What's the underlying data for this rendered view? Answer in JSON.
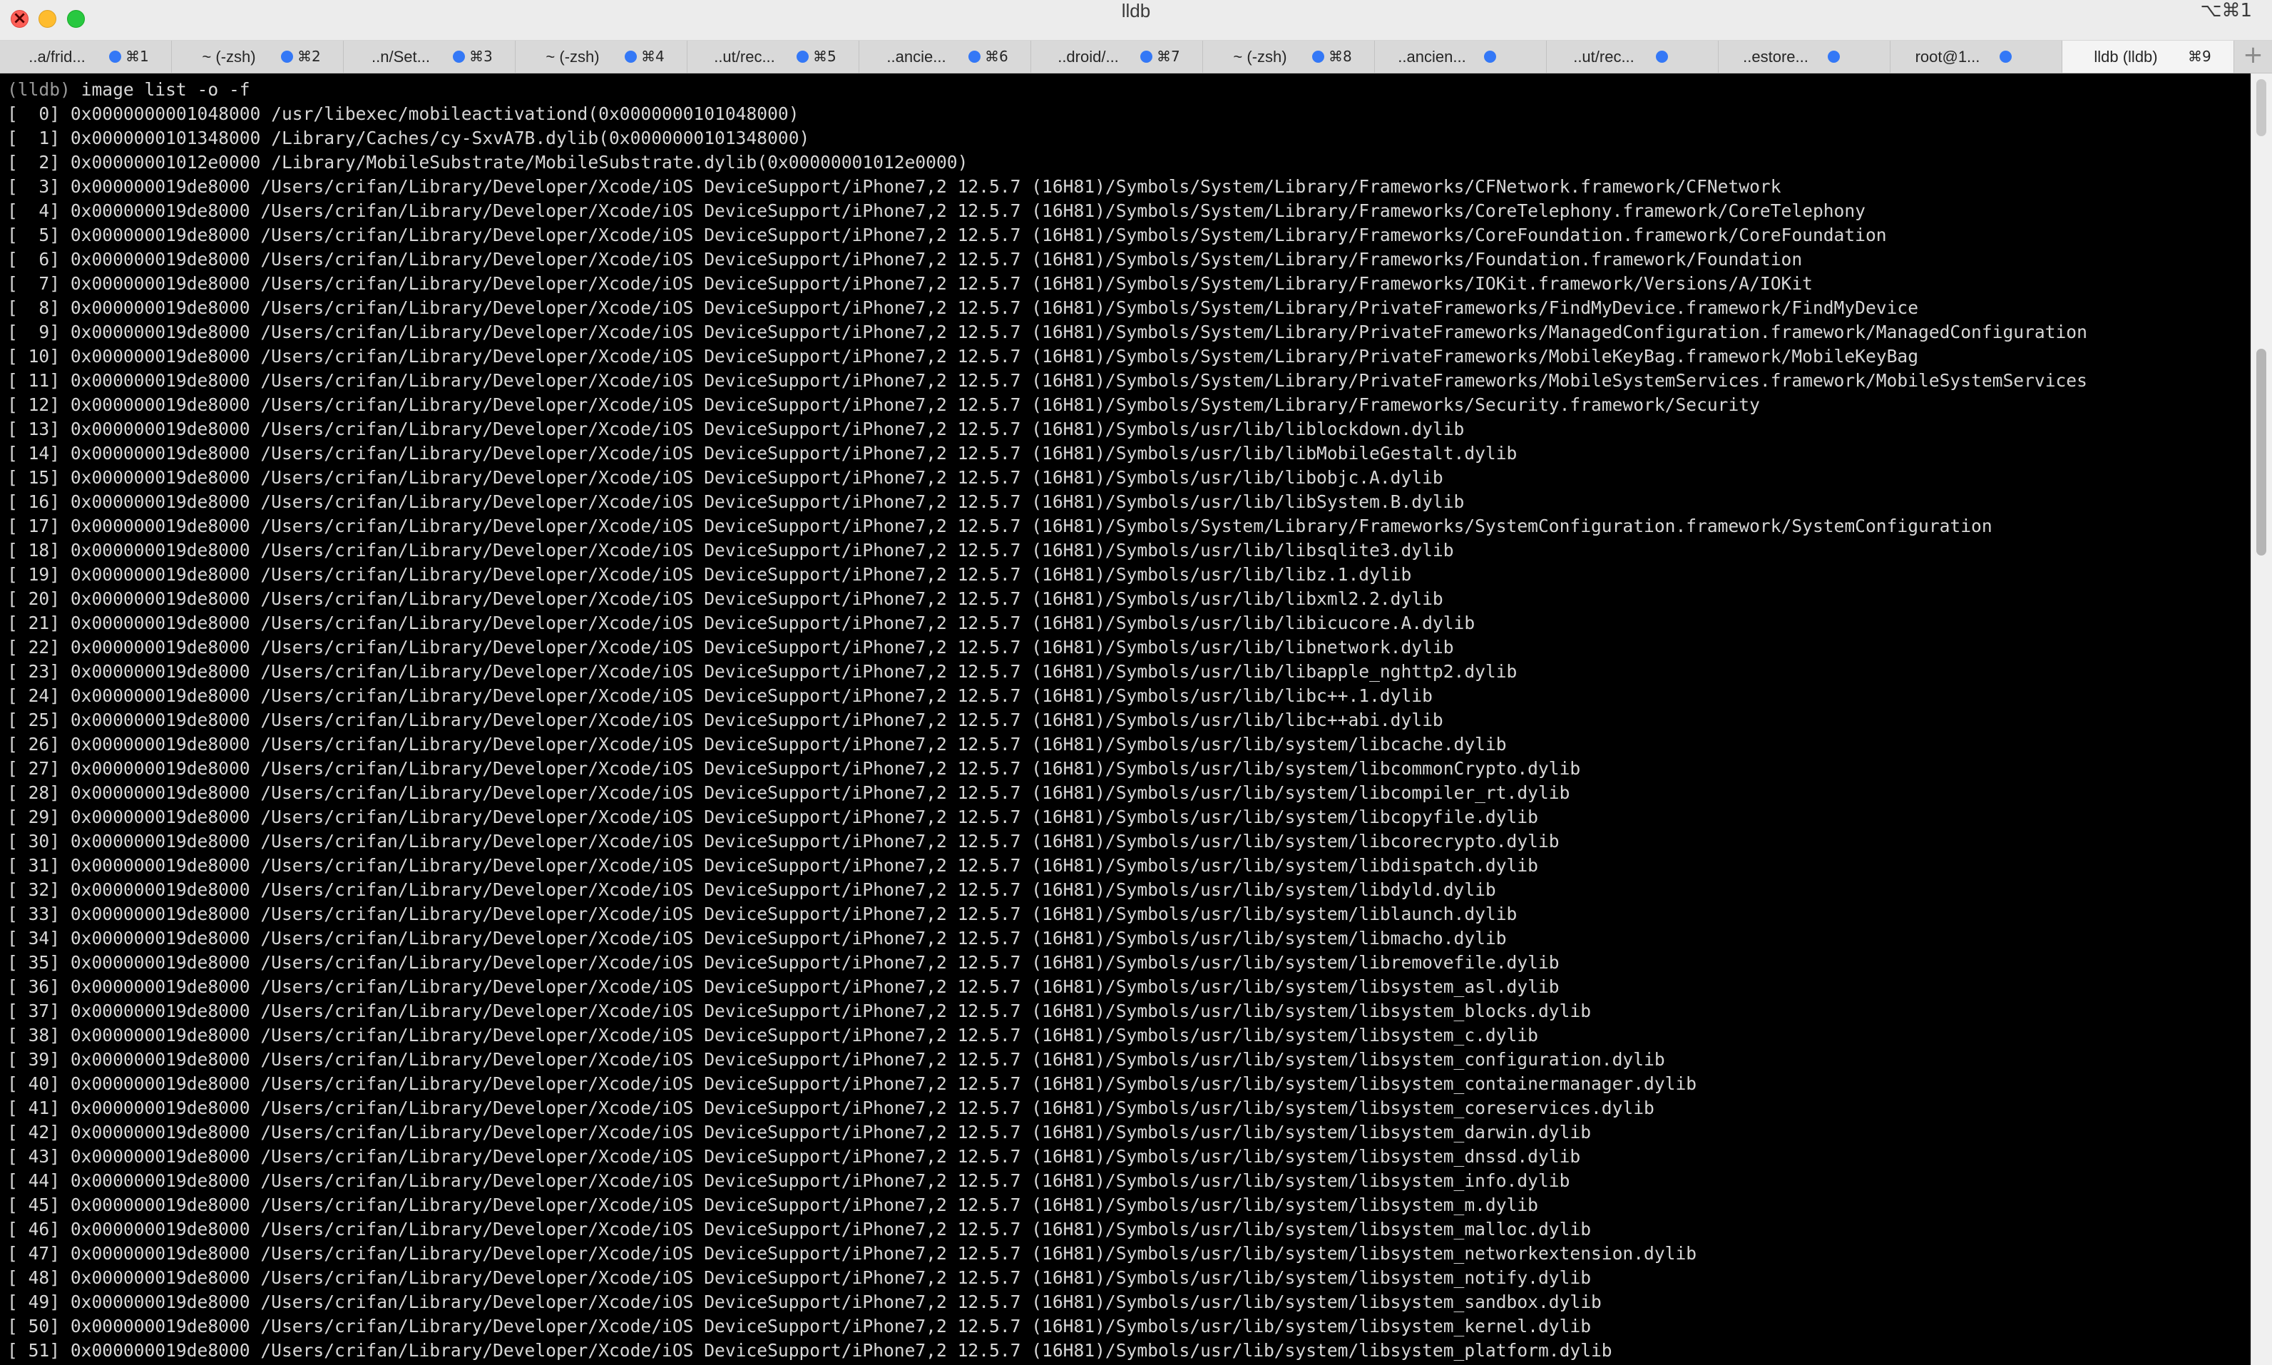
{
  "window": {
    "title": "lldb",
    "shortcut": "⌥⌘1"
  },
  "tabs": [
    {
      "title": "..a/frid...",
      "key": "⌘1"
    },
    {
      "title": "~ (-zsh)",
      "key": "⌘2"
    },
    {
      "title": "..n/Set...",
      "key": "⌘3"
    },
    {
      "title": "~ (-zsh)",
      "key": "⌘4"
    },
    {
      "title": "..ut/rec...",
      "key": "⌘5"
    },
    {
      "title": "..ancie...",
      "key": "⌘6"
    },
    {
      "title": "..droid/...",
      "key": "⌘7"
    },
    {
      "title": "~ (-zsh)",
      "key": "⌘8"
    },
    {
      "title": "..ancien...",
      "key": ""
    },
    {
      "title": "..ut/rec...",
      "key": ""
    },
    {
      "title": "..estore...",
      "key": ""
    },
    {
      "title": "root@1...",
      "key": ""
    },
    {
      "title": "lldb (lldb)",
      "key": "⌘9",
      "active": true
    }
  ],
  "new_tab_label": "+",
  "terminal": {
    "prompt": "(lldb)",
    "command": " image list -o -f",
    "lines": [
      "[  0] 0x0000000001048000 /usr/libexec/mobileactivationd(0x0000000101048000)",
      "[  1] 0x0000000101348000 /Library/Caches/cy-SxvA7B.dylib(0x0000000101348000)",
      "[  2] 0x00000001012e0000 /Library/MobileSubstrate/MobileSubstrate.dylib(0x00000001012e0000)",
      "[  3] 0x000000019de8000 /Users/crifan/Library/Developer/Xcode/iOS DeviceSupport/iPhone7,2 12.5.7 (16H81)/Symbols/System/Library/Frameworks/CFNetwork.framework/CFNetwork",
      "[  4] 0x000000019de8000 /Users/crifan/Library/Developer/Xcode/iOS DeviceSupport/iPhone7,2 12.5.7 (16H81)/Symbols/System/Library/Frameworks/CoreTelephony.framework/CoreTelephony",
      "[  5] 0x000000019de8000 /Users/crifan/Library/Developer/Xcode/iOS DeviceSupport/iPhone7,2 12.5.7 (16H81)/Symbols/System/Library/Frameworks/CoreFoundation.framework/CoreFoundation",
      "[  6] 0x000000019de8000 /Users/crifan/Library/Developer/Xcode/iOS DeviceSupport/iPhone7,2 12.5.7 (16H81)/Symbols/System/Library/Frameworks/Foundation.framework/Foundation",
      "[  7] 0x000000019de8000 /Users/crifan/Library/Developer/Xcode/iOS DeviceSupport/iPhone7,2 12.5.7 (16H81)/Symbols/System/Library/Frameworks/IOKit.framework/Versions/A/IOKit",
      "[  8] 0x000000019de8000 /Users/crifan/Library/Developer/Xcode/iOS DeviceSupport/iPhone7,2 12.5.7 (16H81)/Symbols/System/Library/PrivateFrameworks/FindMyDevice.framework/FindMyDevice",
      "[  9] 0x000000019de8000 /Users/crifan/Library/Developer/Xcode/iOS DeviceSupport/iPhone7,2 12.5.7 (16H81)/Symbols/System/Library/PrivateFrameworks/ManagedConfiguration.framework/ManagedConfiguration",
      "[ 10] 0x000000019de8000 /Users/crifan/Library/Developer/Xcode/iOS DeviceSupport/iPhone7,2 12.5.7 (16H81)/Symbols/System/Library/PrivateFrameworks/MobileKeyBag.framework/MobileKeyBag",
      "[ 11] 0x000000019de8000 /Users/crifan/Library/Developer/Xcode/iOS DeviceSupport/iPhone7,2 12.5.7 (16H81)/Symbols/System/Library/PrivateFrameworks/MobileSystemServices.framework/MobileSystemServices",
      "[ 12] 0x000000019de8000 /Users/crifan/Library/Developer/Xcode/iOS DeviceSupport/iPhone7,2 12.5.7 (16H81)/Symbols/System/Library/Frameworks/Security.framework/Security",
      "[ 13] 0x000000019de8000 /Users/crifan/Library/Developer/Xcode/iOS DeviceSupport/iPhone7,2 12.5.7 (16H81)/Symbols/usr/lib/liblockdown.dylib",
      "[ 14] 0x000000019de8000 /Users/crifan/Library/Developer/Xcode/iOS DeviceSupport/iPhone7,2 12.5.7 (16H81)/Symbols/usr/lib/libMobileGestalt.dylib",
      "[ 15] 0x000000019de8000 /Users/crifan/Library/Developer/Xcode/iOS DeviceSupport/iPhone7,2 12.5.7 (16H81)/Symbols/usr/lib/libobjc.A.dylib",
      "[ 16] 0x000000019de8000 /Users/crifan/Library/Developer/Xcode/iOS DeviceSupport/iPhone7,2 12.5.7 (16H81)/Symbols/usr/lib/libSystem.B.dylib",
      "[ 17] 0x000000019de8000 /Users/crifan/Library/Developer/Xcode/iOS DeviceSupport/iPhone7,2 12.5.7 (16H81)/Symbols/System/Library/Frameworks/SystemConfiguration.framework/SystemConfiguration",
      "[ 18] 0x000000019de8000 /Users/crifan/Library/Developer/Xcode/iOS DeviceSupport/iPhone7,2 12.5.7 (16H81)/Symbols/usr/lib/libsqlite3.dylib",
      "[ 19] 0x000000019de8000 /Users/crifan/Library/Developer/Xcode/iOS DeviceSupport/iPhone7,2 12.5.7 (16H81)/Symbols/usr/lib/libz.1.dylib",
      "[ 20] 0x000000019de8000 /Users/crifan/Library/Developer/Xcode/iOS DeviceSupport/iPhone7,2 12.5.7 (16H81)/Symbols/usr/lib/libxml2.2.dylib",
      "[ 21] 0x000000019de8000 /Users/crifan/Library/Developer/Xcode/iOS DeviceSupport/iPhone7,2 12.5.7 (16H81)/Symbols/usr/lib/libicucore.A.dylib",
      "[ 22] 0x000000019de8000 /Users/crifan/Library/Developer/Xcode/iOS DeviceSupport/iPhone7,2 12.5.7 (16H81)/Symbols/usr/lib/libnetwork.dylib",
      "[ 23] 0x000000019de8000 /Users/crifan/Library/Developer/Xcode/iOS DeviceSupport/iPhone7,2 12.5.7 (16H81)/Symbols/usr/lib/libapple_nghttp2.dylib",
      "[ 24] 0x000000019de8000 /Users/crifan/Library/Developer/Xcode/iOS DeviceSupport/iPhone7,2 12.5.7 (16H81)/Symbols/usr/lib/libc++.1.dylib",
      "[ 25] 0x000000019de8000 /Users/crifan/Library/Developer/Xcode/iOS DeviceSupport/iPhone7,2 12.5.7 (16H81)/Symbols/usr/lib/libc++abi.dylib",
      "[ 26] 0x000000019de8000 /Users/crifan/Library/Developer/Xcode/iOS DeviceSupport/iPhone7,2 12.5.7 (16H81)/Symbols/usr/lib/system/libcache.dylib",
      "[ 27] 0x000000019de8000 /Users/crifan/Library/Developer/Xcode/iOS DeviceSupport/iPhone7,2 12.5.7 (16H81)/Symbols/usr/lib/system/libcommonCrypto.dylib",
      "[ 28] 0x000000019de8000 /Users/crifan/Library/Developer/Xcode/iOS DeviceSupport/iPhone7,2 12.5.7 (16H81)/Symbols/usr/lib/system/libcompiler_rt.dylib",
      "[ 29] 0x000000019de8000 /Users/crifan/Library/Developer/Xcode/iOS DeviceSupport/iPhone7,2 12.5.7 (16H81)/Symbols/usr/lib/system/libcopyfile.dylib",
      "[ 30] 0x000000019de8000 /Users/crifan/Library/Developer/Xcode/iOS DeviceSupport/iPhone7,2 12.5.7 (16H81)/Symbols/usr/lib/system/libcorecrypto.dylib",
      "[ 31] 0x000000019de8000 /Users/crifan/Library/Developer/Xcode/iOS DeviceSupport/iPhone7,2 12.5.7 (16H81)/Symbols/usr/lib/system/libdispatch.dylib",
      "[ 32] 0x000000019de8000 /Users/crifan/Library/Developer/Xcode/iOS DeviceSupport/iPhone7,2 12.5.7 (16H81)/Symbols/usr/lib/system/libdyld.dylib",
      "[ 33] 0x000000019de8000 /Users/crifan/Library/Developer/Xcode/iOS DeviceSupport/iPhone7,2 12.5.7 (16H81)/Symbols/usr/lib/system/liblaunch.dylib",
      "[ 34] 0x000000019de8000 /Users/crifan/Library/Developer/Xcode/iOS DeviceSupport/iPhone7,2 12.5.7 (16H81)/Symbols/usr/lib/system/libmacho.dylib",
      "[ 35] 0x000000019de8000 /Users/crifan/Library/Developer/Xcode/iOS DeviceSupport/iPhone7,2 12.5.7 (16H81)/Symbols/usr/lib/system/libremovefile.dylib",
      "[ 36] 0x000000019de8000 /Users/crifan/Library/Developer/Xcode/iOS DeviceSupport/iPhone7,2 12.5.7 (16H81)/Symbols/usr/lib/system/libsystem_asl.dylib",
      "[ 37] 0x000000019de8000 /Users/crifan/Library/Developer/Xcode/iOS DeviceSupport/iPhone7,2 12.5.7 (16H81)/Symbols/usr/lib/system/libsystem_blocks.dylib",
      "[ 38] 0x000000019de8000 /Users/crifan/Library/Developer/Xcode/iOS DeviceSupport/iPhone7,2 12.5.7 (16H81)/Symbols/usr/lib/system/libsystem_c.dylib",
      "[ 39] 0x000000019de8000 /Users/crifan/Library/Developer/Xcode/iOS DeviceSupport/iPhone7,2 12.5.7 (16H81)/Symbols/usr/lib/system/libsystem_configuration.dylib",
      "[ 40] 0x000000019de8000 /Users/crifan/Library/Developer/Xcode/iOS DeviceSupport/iPhone7,2 12.5.7 (16H81)/Symbols/usr/lib/system/libsystem_containermanager.dylib",
      "[ 41] 0x000000019de8000 /Users/crifan/Library/Developer/Xcode/iOS DeviceSupport/iPhone7,2 12.5.7 (16H81)/Symbols/usr/lib/system/libsystem_coreservices.dylib",
      "[ 42] 0x000000019de8000 /Users/crifan/Library/Developer/Xcode/iOS DeviceSupport/iPhone7,2 12.5.7 (16H81)/Symbols/usr/lib/system/libsystem_darwin.dylib",
      "[ 43] 0x000000019de8000 /Users/crifan/Library/Developer/Xcode/iOS DeviceSupport/iPhone7,2 12.5.7 (16H81)/Symbols/usr/lib/system/libsystem_dnssd.dylib",
      "[ 44] 0x000000019de8000 /Users/crifan/Library/Developer/Xcode/iOS DeviceSupport/iPhone7,2 12.5.7 (16H81)/Symbols/usr/lib/system/libsystem_info.dylib",
      "[ 45] 0x000000019de8000 /Users/crifan/Library/Developer/Xcode/iOS DeviceSupport/iPhone7,2 12.5.7 (16H81)/Symbols/usr/lib/system/libsystem_m.dylib",
      "[ 46] 0x000000019de8000 /Users/crifan/Library/Developer/Xcode/iOS DeviceSupport/iPhone7,2 12.5.7 (16H81)/Symbols/usr/lib/system/libsystem_malloc.dylib",
      "[ 47] 0x000000019de8000 /Users/crifan/Library/Developer/Xcode/iOS DeviceSupport/iPhone7,2 12.5.7 (16H81)/Symbols/usr/lib/system/libsystem_networkextension.dylib",
      "[ 48] 0x000000019de8000 /Users/crifan/Library/Developer/Xcode/iOS DeviceSupport/iPhone7,2 12.5.7 (16H81)/Symbols/usr/lib/system/libsystem_notify.dylib",
      "[ 49] 0x000000019de8000 /Users/crifan/Library/Developer/Xcode/iOS DeviceSupport/iPhone7,2 12.5.7 (16H81)/Symbols/usr/lib/system/libsystem_sandbox.dylib",
      "[ 50] 0x000000019de8000 /Users/crifan/Library/Developer/Xcode/iOS DeviceSupport/iPhone7,2 12.5.7 (16H81)/Symbols/usr/lib/system/libsystem_kernel.dylib",
      "[ 51] 0x000000019de8000 /Users/crifan/Library/Developer/Xcode/iOS DeviceSupport/iPhone7,2 12.5.7 (16H81)/Symbols/usr/lib/system/libsystem_platform.dylib"
    ]
  },
  "colors": {
    "terminal_bg": "#000000",
    "terminal_fg": "#d7d7d7",
    "tab_activity_dot": "#3478f6",
    "close_button": "#fe5f57",
    "minimize_button": "#febc2e",
    "zoom_button": "#28c840"
  }
}
